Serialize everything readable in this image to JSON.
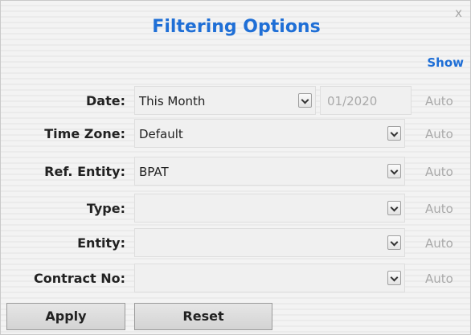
{
  "dialog": {
    "title": "Filtering Options",
    "close_label": "x",
    "show_link": "Show"
  },
  "filters": {
    "date": {
      "label": "Date:",
      "value": "This Month",
      "date_value": "01/2020",
      "auto_label": "Auto"
    },
    "time_zone": {
      "label": "Time Zone:",
      "value": "Default",
      "auto_label": "Auto"
    },
    "ref_entity": {
      "label": "Ref. Entity:",
      "value": "BPAT",
      "auto_label": "Auto"
    },
    "type": {
      "label": "Type:",
      "value": "",
      "auto_label": "Auto"
    },
    "entity": {
      "label": "Entity:",
      "value": "",
      "auto_label": "Auto"
    },
    "contract_no": {
      "label": "Contract No:",
      "value": "",
      "auto_label": "Auto"
    }
  },
  "buttons": {
    "apply": "Apply",
    "reset": "Reset"
  },
  "colors": {
    "accent": "#1f6fd6",
    "disabled_text": "#a9a9a9"
  }
}
